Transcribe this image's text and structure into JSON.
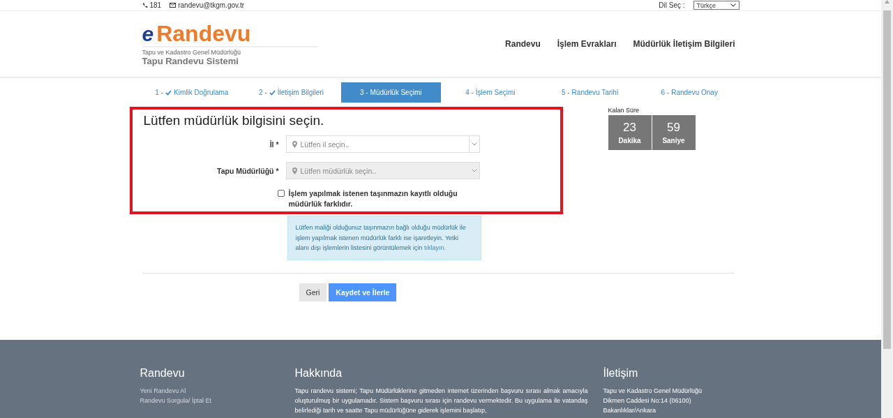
{
  "top_bar": {
    "phone": "181",
    "email": "randevu@tkgm.gov.tr",
    "language_label": "Dil Seç :",
    "language_value": "Türkçe"
  },
  "header": {
    "logo_e": "e",
    "logo_text": "Randevu",
    "org": "Tapu ve Kadastro Genel Müdürlüğü",
    "system": "Tapu Randevu Sistemi",
    "nav": [
      "Randevu",
      "İşlem Evrakları",
      "Müdürlük İletişim Bilgileri"
    ]
  },
  "steps": [
    {
      "number": "1 -",
      "label": "Kimlik Doğrulama",
      "done": true,
      "selected": false
    },
    {
      "number": "2 -",
      "label": "İletişim Bilgileri",
      "done": true,
      "selected": false
    },
    {
      "number": "3 -",
      "label": "Müdürlük Seçimi",
      "done": false,
      "selected": true
    },
    {
      "number": "4 -",
      "label": "İşlem Seçimi",
      "done": false,
      "selected": false
    },
    {
      "number": "5 -",
      "label": "Randevu Tarihi",
      "done": false,
      "selected": false
    },
    {
      "number": "6 -",
      "label": "Randevu Onay",
      "done": false,
      "selected": false
    }
  ],
  "form": {
    "title": "Lütfen müdürlük bilgisini seçin.",
    "fields": [
      {
        "label": "İl *",
        "placeholder": "Lütfen il seçin..",
        "disabled": false
      },
      {
        "label": "Tapu Müdürlüğü *",
        "placeholder": "Lütfen müdürlük seçin..",
        "disabled": true
      }
    ],
    "checkbox": {
      "label": "İşlem yapılmak istenen taşınmazın kayıtlı olduğu müdürlük farklıdır.",
      "checked": false
    },
    "info": {
      "text": "Lütfen maliği olduğunuz taşınmazın bağlı olduğu müdürlük ile işlem yapılmak istenen müdürlük farklı ise işaretleyin. Yetki alanı dışı işlemlerin listesini görüntülemek için",
      "link": "tıklayın."
    },
    "buttons": [
      {
        "label": "Geri",
        "kind": "secondary"
      },
      {
        "label": "Kaydet ve İlerle",
        "kind": "primary"
      }
    ]
  },
  "timer": {
    "title": "Kalan Süre",
    "units": [
      {
        "value": "23",
        "unit": "Dakika"
      },
      {
        "value": "59",
        "unit": "Saniye"
      }
    ]
  },
  "footer": {
    "columns": [
      {
        "kind": "links",
        "title": "Randevu",
        "items": [
          "Yeni Randevu Al",
          "Randevu Sorgula/ İptal Et"
        ]
      },
      {
        "kind": "paragraph",
        "title": "Hakkında",
        "items": [
          "Tapu randevu sistemi; Tapu Müdürlüklerine gitmeden internet üzerinden başvuru sırası almak amacıyla oluşturulmuş bir uygulamadır. Sistem başvuru sırası için randevu vermektedir. Bu uygulama ile vatandaş belirlediği tarih ve saatte Tapu müdürlüğüne giderek işlemini başlatıp,"
        ]
      },
      {
        "kind": "lines",
        "title": "İletişim",
        "items": [
          "Tapu ve Kadastro Genel Müdürlüğü",
          "Dikmen Caddesi No:14 (06100)",
          "Bakanlıklar/Ankara"
        ]
      }
    ]
  }
}
